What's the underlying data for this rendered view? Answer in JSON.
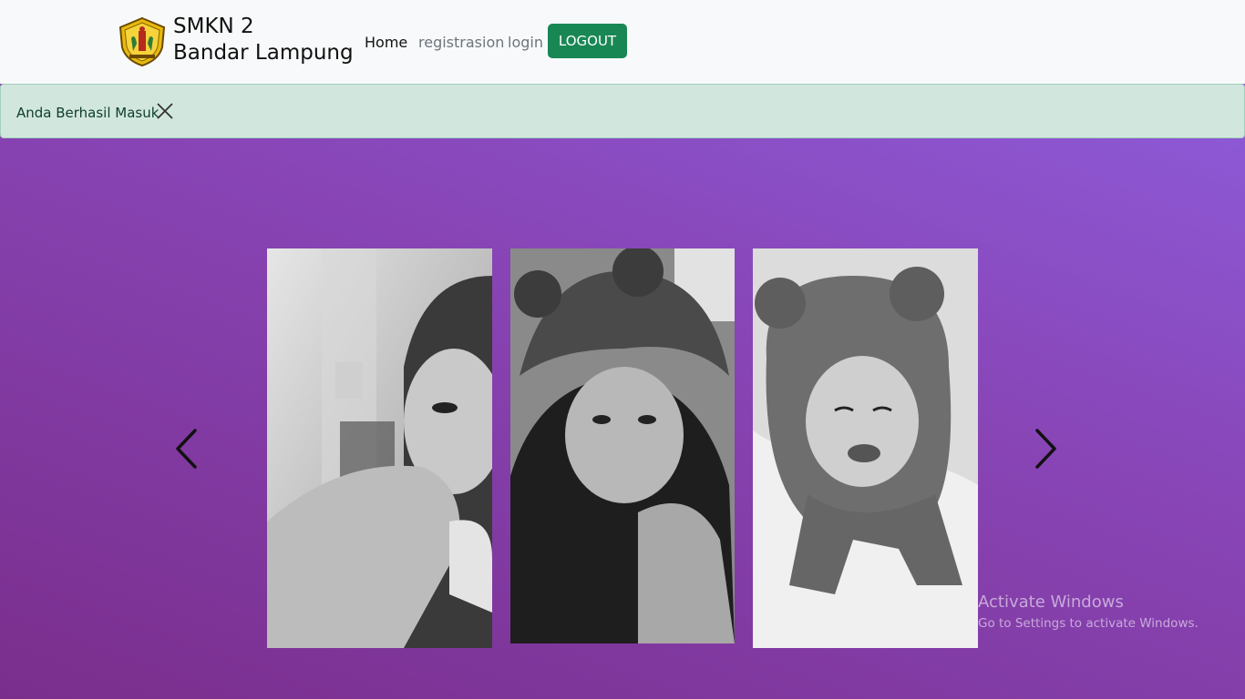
{
  "navbar": {
    "brand_line1": "SMKN 2",
    "brand_line2": "Bandar Lampung",
    "links": [
      {
        "label": "Home",
        "active": true
      },
      {
        "label": "registrasion",
        "active": false
      },
      {
        "label": "login",
        "active": false
      }
    ],
    "logout_label": "LOGOUT",
    "logout_color": "#198754"
  },
  "alert": {
    "message": "Anda Berhasil Masuk",
    "background": "#d1e7dd"
  },
  "carousel": {
    "prev_icon": "chevron-left-icon",
    "next_icon": "chevron-right-icon",
    "photos": [
      {
        "name": "photo-1"
      },
      {
        "name": "photo-2"
      },
      {
        "name": "photo-3"
      }
    ]
  },
  "watermark": {
    "title": "Activate Windows",
    "subtitle": "Go to Settings to activate Windows."
  }
}
